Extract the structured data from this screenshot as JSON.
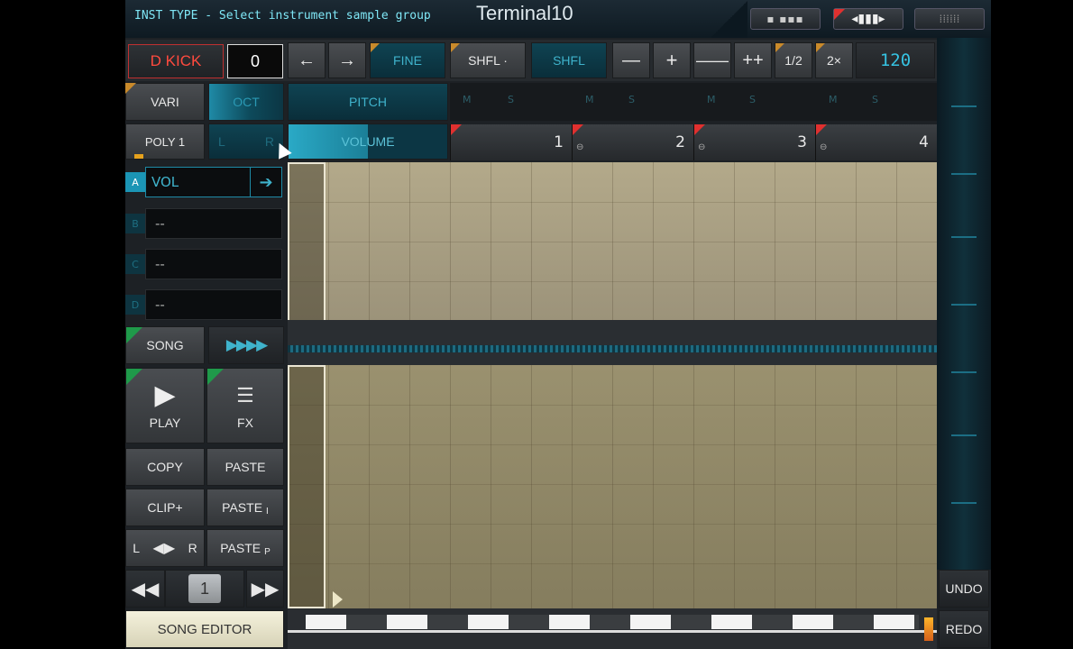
{
  "header": {
    "hint": "INST TYPE - Select instrument sample group",
    "title": "Terminal10"
  },
  "toolbar": {
    "instrument": "D KICK",
    "instrument_value": "0",
    "prev": "←",
    "next": "→",
    "fine": "FINE",
    "shfl_dot": "SHFL ·",
    "shfl": "SHFL",
    "minus": "—",
    "plus": "+",
    "minus2": "——",
    "plus2": "++",
    "half": "1/2",
    "double": "2×",
    "tempo": "120"
  },
  "row2": {
    "vari": "VARI",
    "oct": "OCT",
    "pitch": "PITCH",
    "m": "M",
    "s": "S"
  },
  "row3": {
    "poly": "POLY 1",
    "left": "L",
    "right": "R",
    "volume": "VOLUME",
    "bars": [
      "1",
      "2",
      "3",
      "4"
    ]
  },
  "params": {
    "a_label": "A",
    "a_value": "VOL",
    "b_label": "B",
    "b_value": "--",
    "c_label": "C",
    "c_value": "--",
    "d_label": "D",
    "d_value": "--"
  },
  "left_panel": {
    "song": "SONG",
    "play": "PLAY",
    "fx": "FX",
    "copy": "COPY",
    "paste": "PASTE",
    "clip_plus": "CLIP+",
    "paste_i": "PASTE",
    "paste_i_sub": "I",
    "lr_left": "L",
    "lr_right": "R",
    "paste_p": "PASTE",
    "paste_p_sub": "P",
    "page": "1",
    "song_editor": "SONG EDITOR"
  },
  "right_panel": {
    "undo": "UNDO",
    "redo": "REDO"
  },
  "colors": {
    "accent_teal": "#3fb3cc",
    "instrument_red": "#e0302f",
    "hint_cyan": "#7fe7f6"
  }
}
